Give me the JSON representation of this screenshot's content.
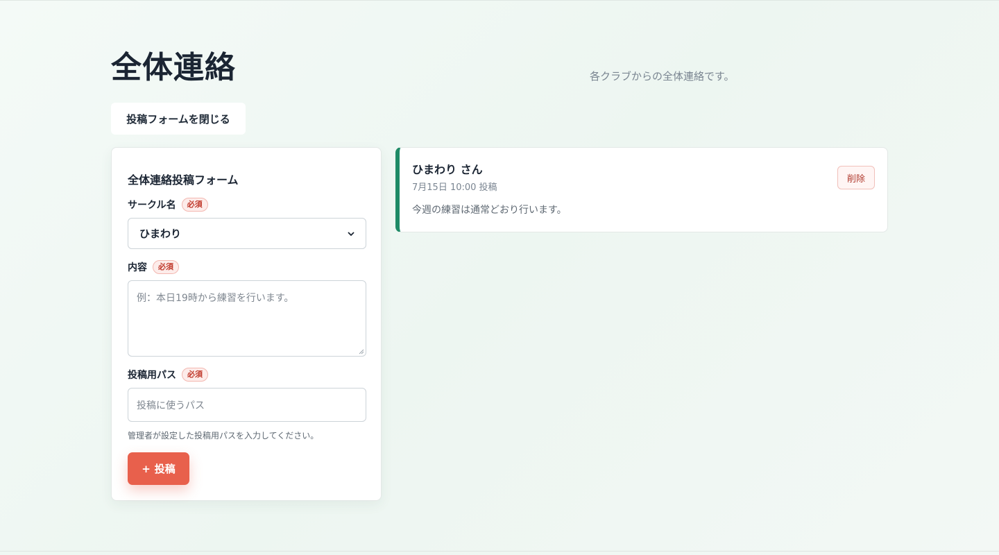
{
  "header": {
    "title": "全体連絡",
    "subtitle": "各クラブからの全体連絡です。"
  },
  "toggle_form_label": "投稿フォームを閉じる",
  "form": {
    "title": "全体連絡投稿フォーム",
    "required_label": "必須",
    "circle": {
      "label": "サークル名",
      "selected": "ひまわり"
    },
    "content": {
      "label": "内容",
      "placeholder": "例：本日19時から練習を行います。"
    },
    "password": {
      "label": "投稿用パス",
      "placeholder": "投稿に使うパス",
      "help": "管理者が設定した投稿用パスを入力してください。"
    },
    "submit": {
      "icon": "+",
      "label": "投稿"
    }
  },
  "posts": [
    {
      "author": "ひまわり さん",
      "meta": "7月15日 10:00 投稿",
      "body": "今週の練習は通常どおり行います。",
      "delete_label": "削除"
    }
  ],
  "colors": {
    "accent": "#e8604c",
    "post_border": "#1e8a66",
    "danger": "#b03a2e"
  }
}
